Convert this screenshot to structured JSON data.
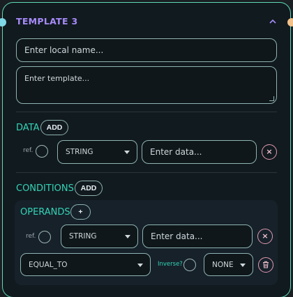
{
  "header": {
    "title": "TEMPLATE 3",
    "collapse_icon": "chevron-up-icon"
  },
  "local_name": {
    "placeholder": "Enter local name..."
  },
  "template": {
    "placeholder": "Enter template..."
  },
  "data_section": {
    "label": "DATA",
    "add_label": "ADD",
    "row": {
      "ref_label": "ref.",
      "type_value": "STRING",
      "data_placeholder": "Enter data...",
      "remove_icon": "×"
    }
  },
  "conditions_section": {
    "label": "CONDITIONS",
    "add_label": "ADD",
    "operands": {
      "label": "OPERANDS",
      "add_icon": "+",
      "row": {
        "ref_label": "ref.",
        "type_value": "STRING",
        "data_placeholder": "Enter data...",
        "remove_icon": "×"
      }
    },
    "operator_value": "EQUAL_TO",
    "inverse_label": "Inverse?",
    "combine_value": "NONE",
    "delete_icon": "trash-icon"
  },
  "colors": {
    "node_border": "#5fd9b6",
    "title": "#a78bfa",
    "section": "#34d3b6",
    "remove": "#e49ab0",
    "port_left": "#7fd8e6",
    "port_right": "#f2c28a"
  }
}
